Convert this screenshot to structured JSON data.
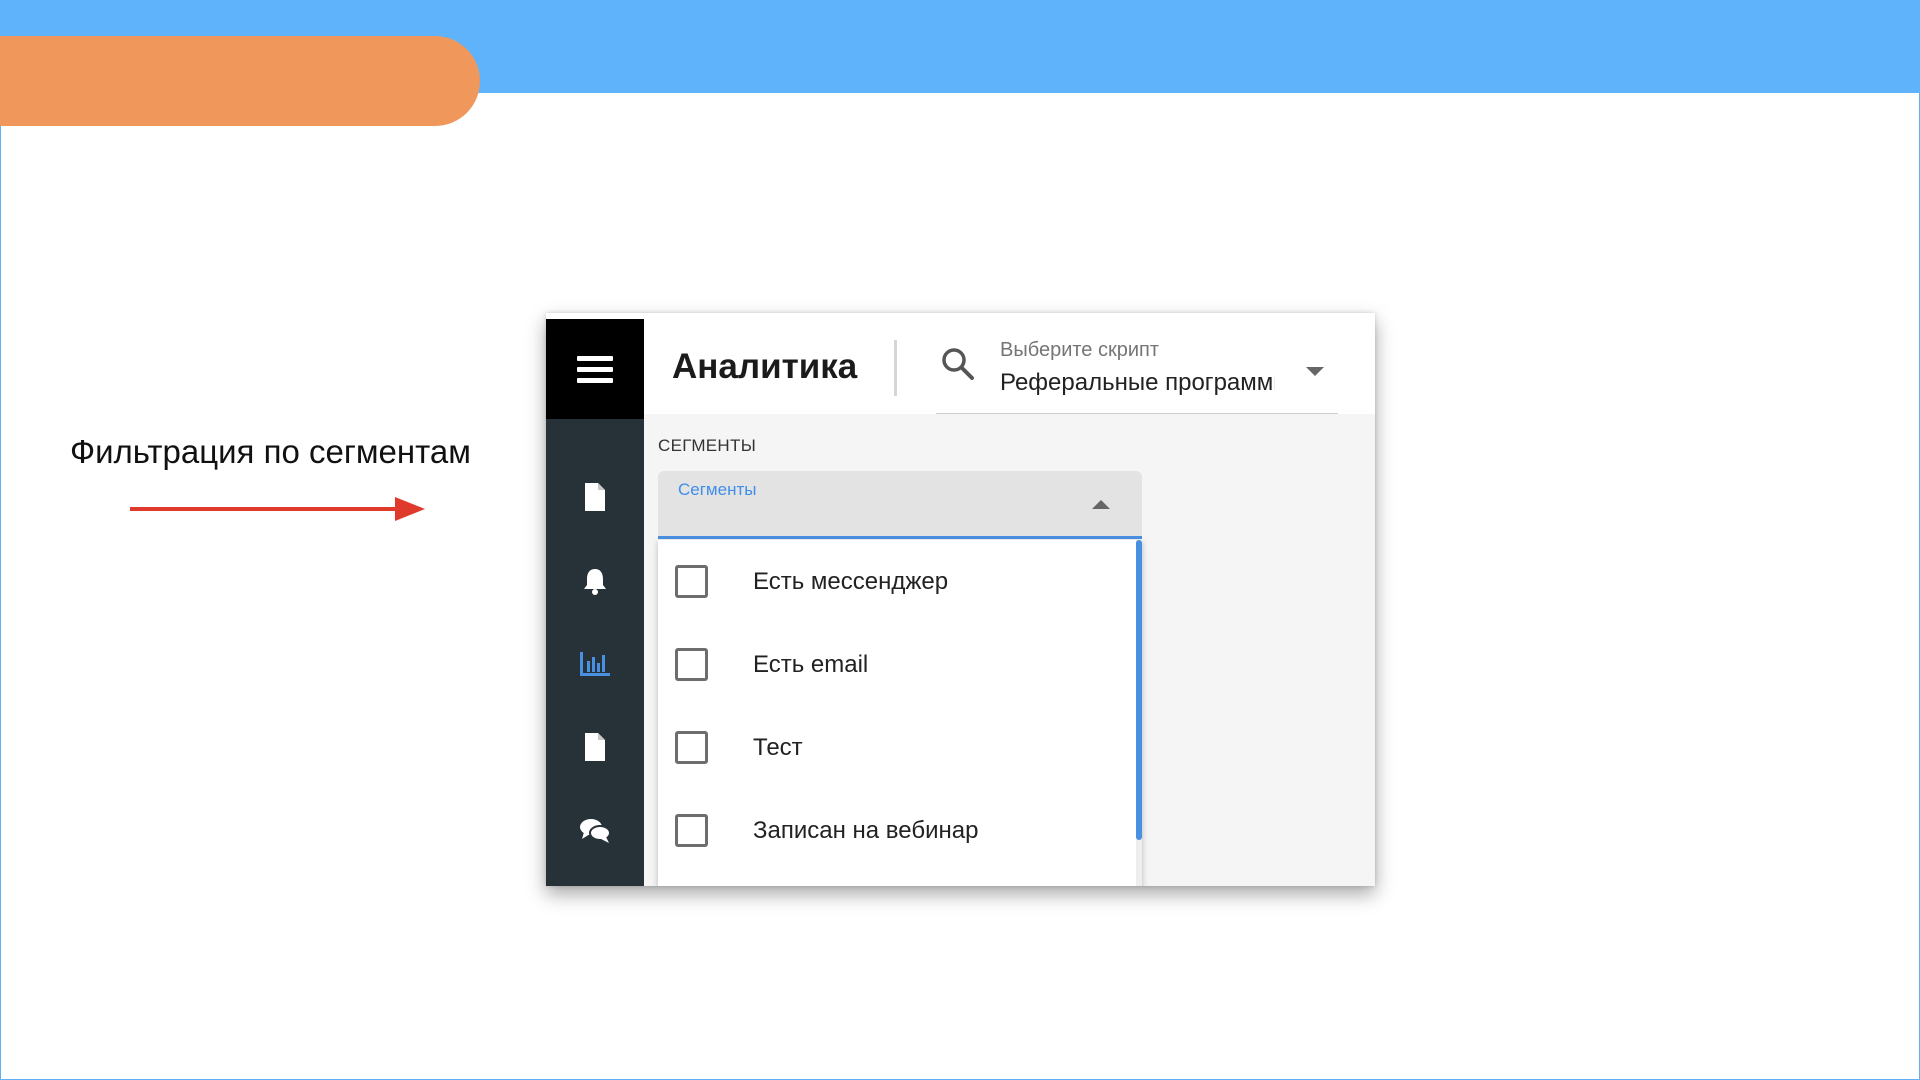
{
  "slide": {
    "caption": "Фильтрация по сегментам",
    "colors": {
      "top_band": "#5fb3fb",
      "accent_pill": "#f0975b",
      "arrow": "#e03a2c"
    }
  },
  "app": {
    "title": "Аналитика",
    "script_select": {
      "label": "Выберите скрипт",
      "value": "Реферальные программы"
    },
    "sidebar": {
      "items": [
        {
          "icon": "menu-icon"
        },
        {
          "icon": "document-icon"
        },
        {
          "icon": "bell-icon"
        },
        {
          "icon": "bar-chart-icon",
          "active": true
        },
        {
          "icon": "document-icon"
        },
        {
          "icon": "chat-icon"
        },
        {
          "icon": "table-icon"
        }
      ],
      "colors": {
        "background": "#263238",
        "active": "#4a90e2"
      }
    },
    "segments": {
      "section_label": "СЕГМЕНТЫ",
      "field_label": "Сегменты",
      "options": [
        {
          "label": "Есть мессенджер",
          "checked": false
        },
        {
          "label": "Есть email",
          "checked": false
        },
        {
          "label": "Тест",
          "checked": false
        },
        {
          "label": "Записан на вебинар",
          "checked": false
        }
      ]
    }
  }
}
